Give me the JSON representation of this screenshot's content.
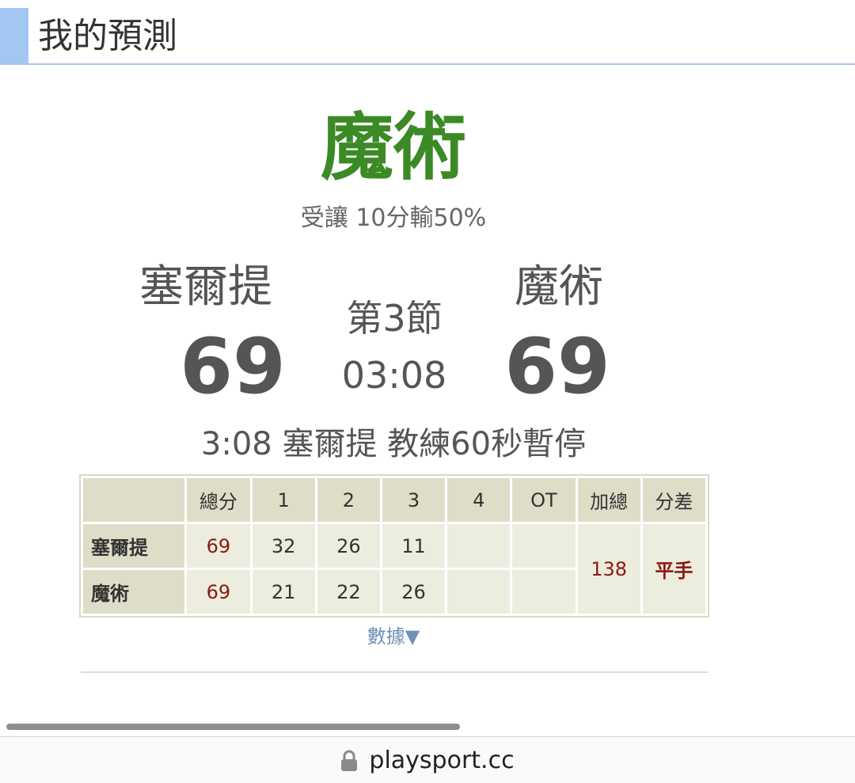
{
  "header": {
    "title": "我的預測"
  },
  "prediction": {
    "team": "魔術",
    "desc": "受讓 10分輸50%"
  },
  "scoreboard": {
    "home_name": "塞爾提",
    "home_score": "69",
    "away_name": "魔術",
    "away_score": "69",
    "period": "第3節",
    "clock": "03:08",
    "event": "3:08 塞爾提 教練60秒暫停"
  },
  "table": {
    "headers": [
      "",
      "總分",
      "1",
      "2",
      "3",
      "4",
      "OT",
      "加總",
      "分差"
    ],
    "rows": [
      {
        "team": "塞爾提",
        "total": "69",
        "q1": "32",
        "q2": "26",
        "q3": "11",
        "q4": "",
        "ot": ""
      },
      {
        "team": "魔術",
        "total": "69",
        "q1": "21",
        "q2": "22",
        "q3": "26",
        "q4": "",
        "ot": ""
      }
    ],
    "sum": "138",
    "diff": "平手"
  },
  "stats_link": "數據▼",
  "browser": {
    "url": "playsport.cc"
  },
  "colors": {
    "pick_team": "#3b8a25",
    "accent": "#a4c6f2",
    "score_red": "#8a1a12",
    "link": "#6f8fb6"
  },
  "icons": {
    "lock": "lock-icon"
  }
}
